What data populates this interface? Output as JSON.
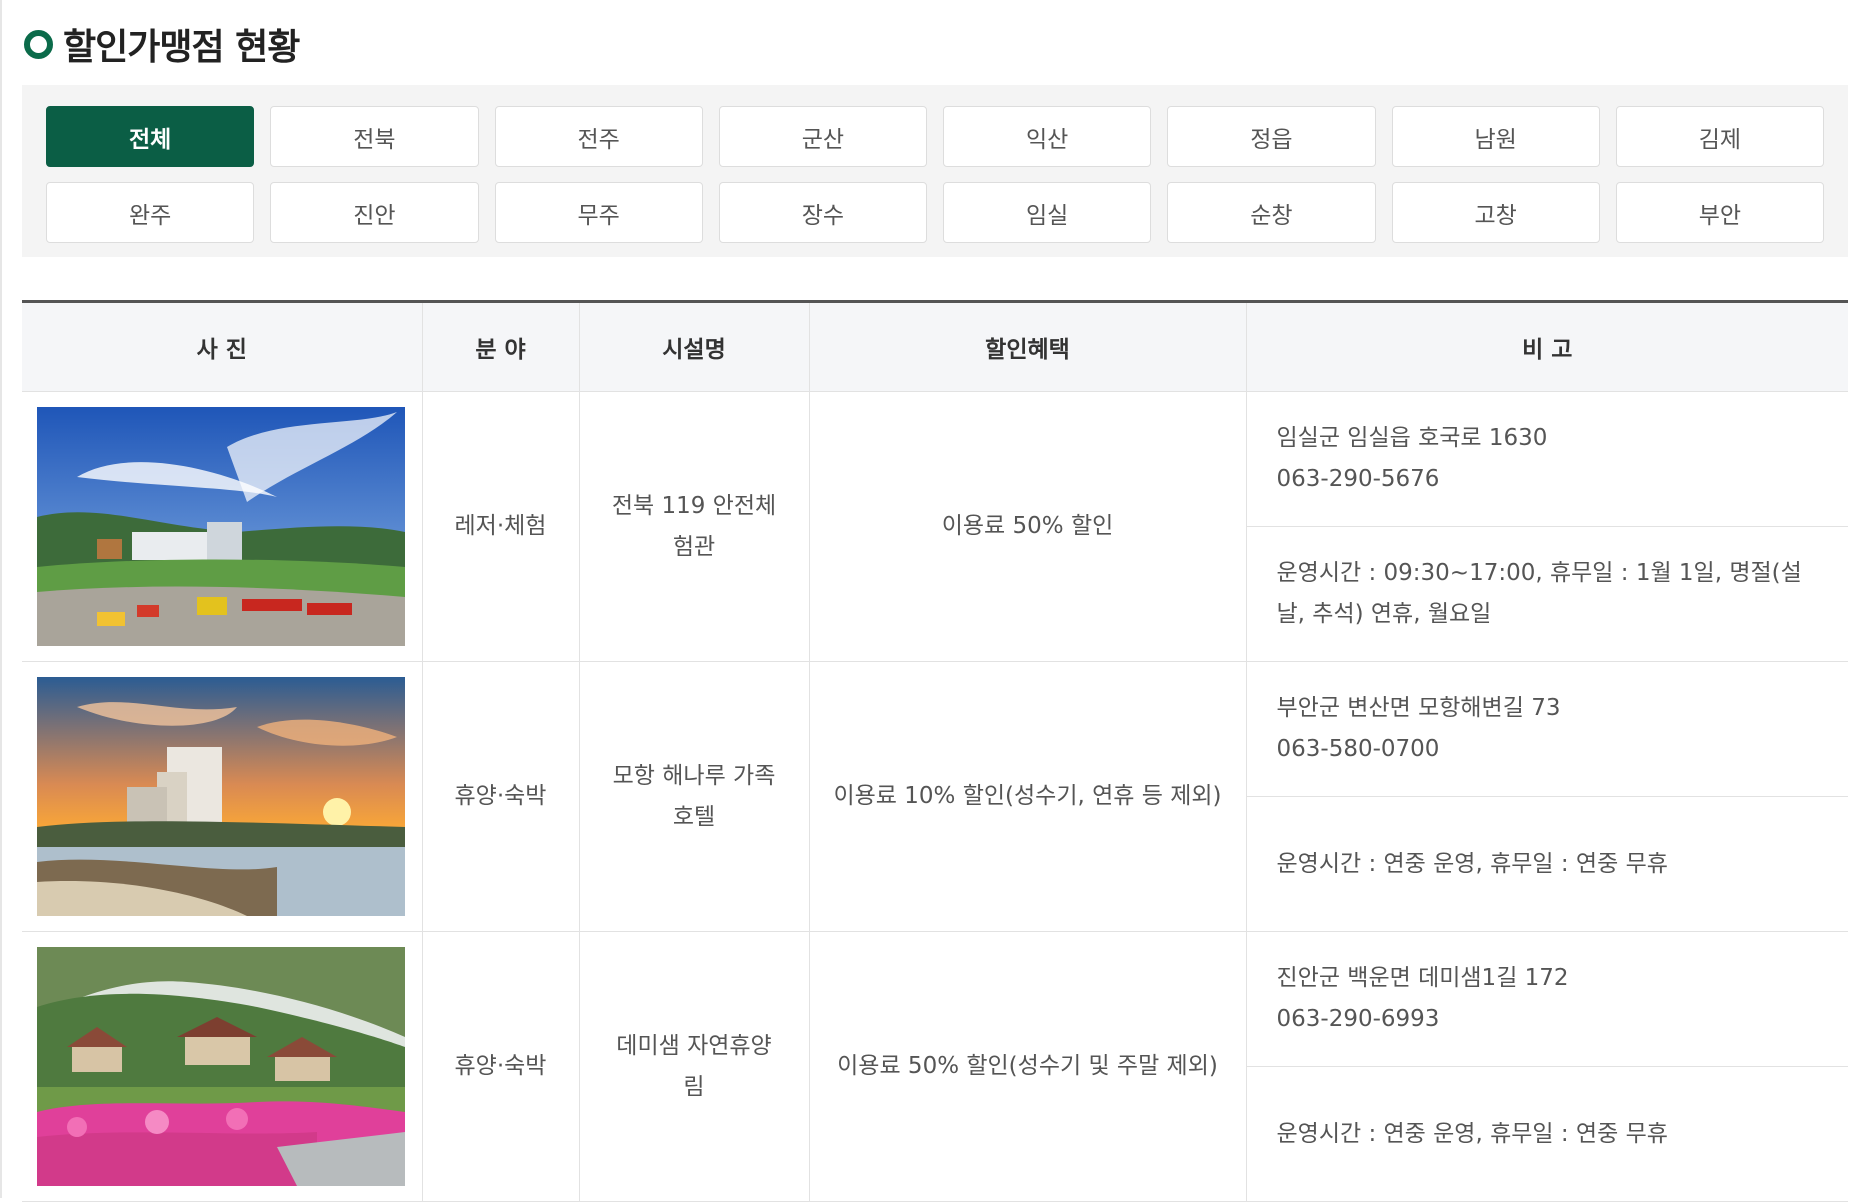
{
  "title": "할인가맹점 현황",
  "regions": [
    {
      "label": "전체",
      "active": true
    },
    {
      "label": "전북",
      "active": false
    },
    {
      "label": "전주",
      "active": false
    },
    {
      "label": "군산",
      "active": false
    },
    {
      "label": "익산",
      "active": false
    },
    {
      "label": "정읍",
      "active": false
    },
    {
      "label": "남원",
      "active": false
    },
    {
      "label": "김제",
      "active": false
    },
    {
      "label": "완주",
      "active": false
    },
    {
      "label": "진안",
      "active": false
    },
    {
      "label": "무주",
      "active": false
    },
    {
      "label": "장수",
      "active": false
    },
    {
      "label": "임실",
      "active": false
    },
    {
      "label": "순창",
      "active": false
    },
    {
      "label": "고창",
      "active": false
    },
    {
      "label": "부안",
      "active": false
    }
  ],
  "table": {
    "headers": {
      "photo": "사 진",
      "category": "분 야",
      "facility": "시설명",
      "benefit": "할인혜택",
      "note": "비 고"
    },
    "rows": [
      {
        "photo_alt": "전북 119 안전체험관 전경",
        "category": "레저·체험",
        "facility": "전북 119 안전체험관",
        "benefit": "이용료 50% 할인",
        "address": "임실군 임실읍 호국로 1630",
        "phone": "063-290-5676",
        "hours": "운영시간 : 09:30~17:00, 휴무일 : 1월 1일, 명절(설날, 추석) 연휴, 월요일"
      },
      {
        "photo_alt": "모항 해나루 가족호텔 일몰",
        "category": "휴양·숙박",
        "facility": "모항 해나루 가족호텔",
        "benefit": "이용료 10% 할인(성수기, 연휴 등 제외)",
        "address": "부안군 변산면 모항해변길 73",
        "phone": "063-580-0700",
        "hours": "운영시간 : 연중 운영, 휴무일 : 연중 무휴"
      },
      {
        "photo_alt": "데미샘 자연휴양림 전경",
        "category": "휴양·숙박",
        "facility": "데미샘 자연휴양림",
        "benefit": "이용료 50% 할인(성수기 및 주말 제외)",
        "address": "진안군 백운면 데미샘1길 172",
        "phone": "063-290-6993",
        "hours": "운영시간 : 연중 운영, 휴무일 : 연중 무휴"
      }
    ]
  },
  "colors": {
    "accent": "#0b5e45",
    "panel_bg": "#f4f4f4",
    "header_bg": "#f5f6f8"
  }
}
